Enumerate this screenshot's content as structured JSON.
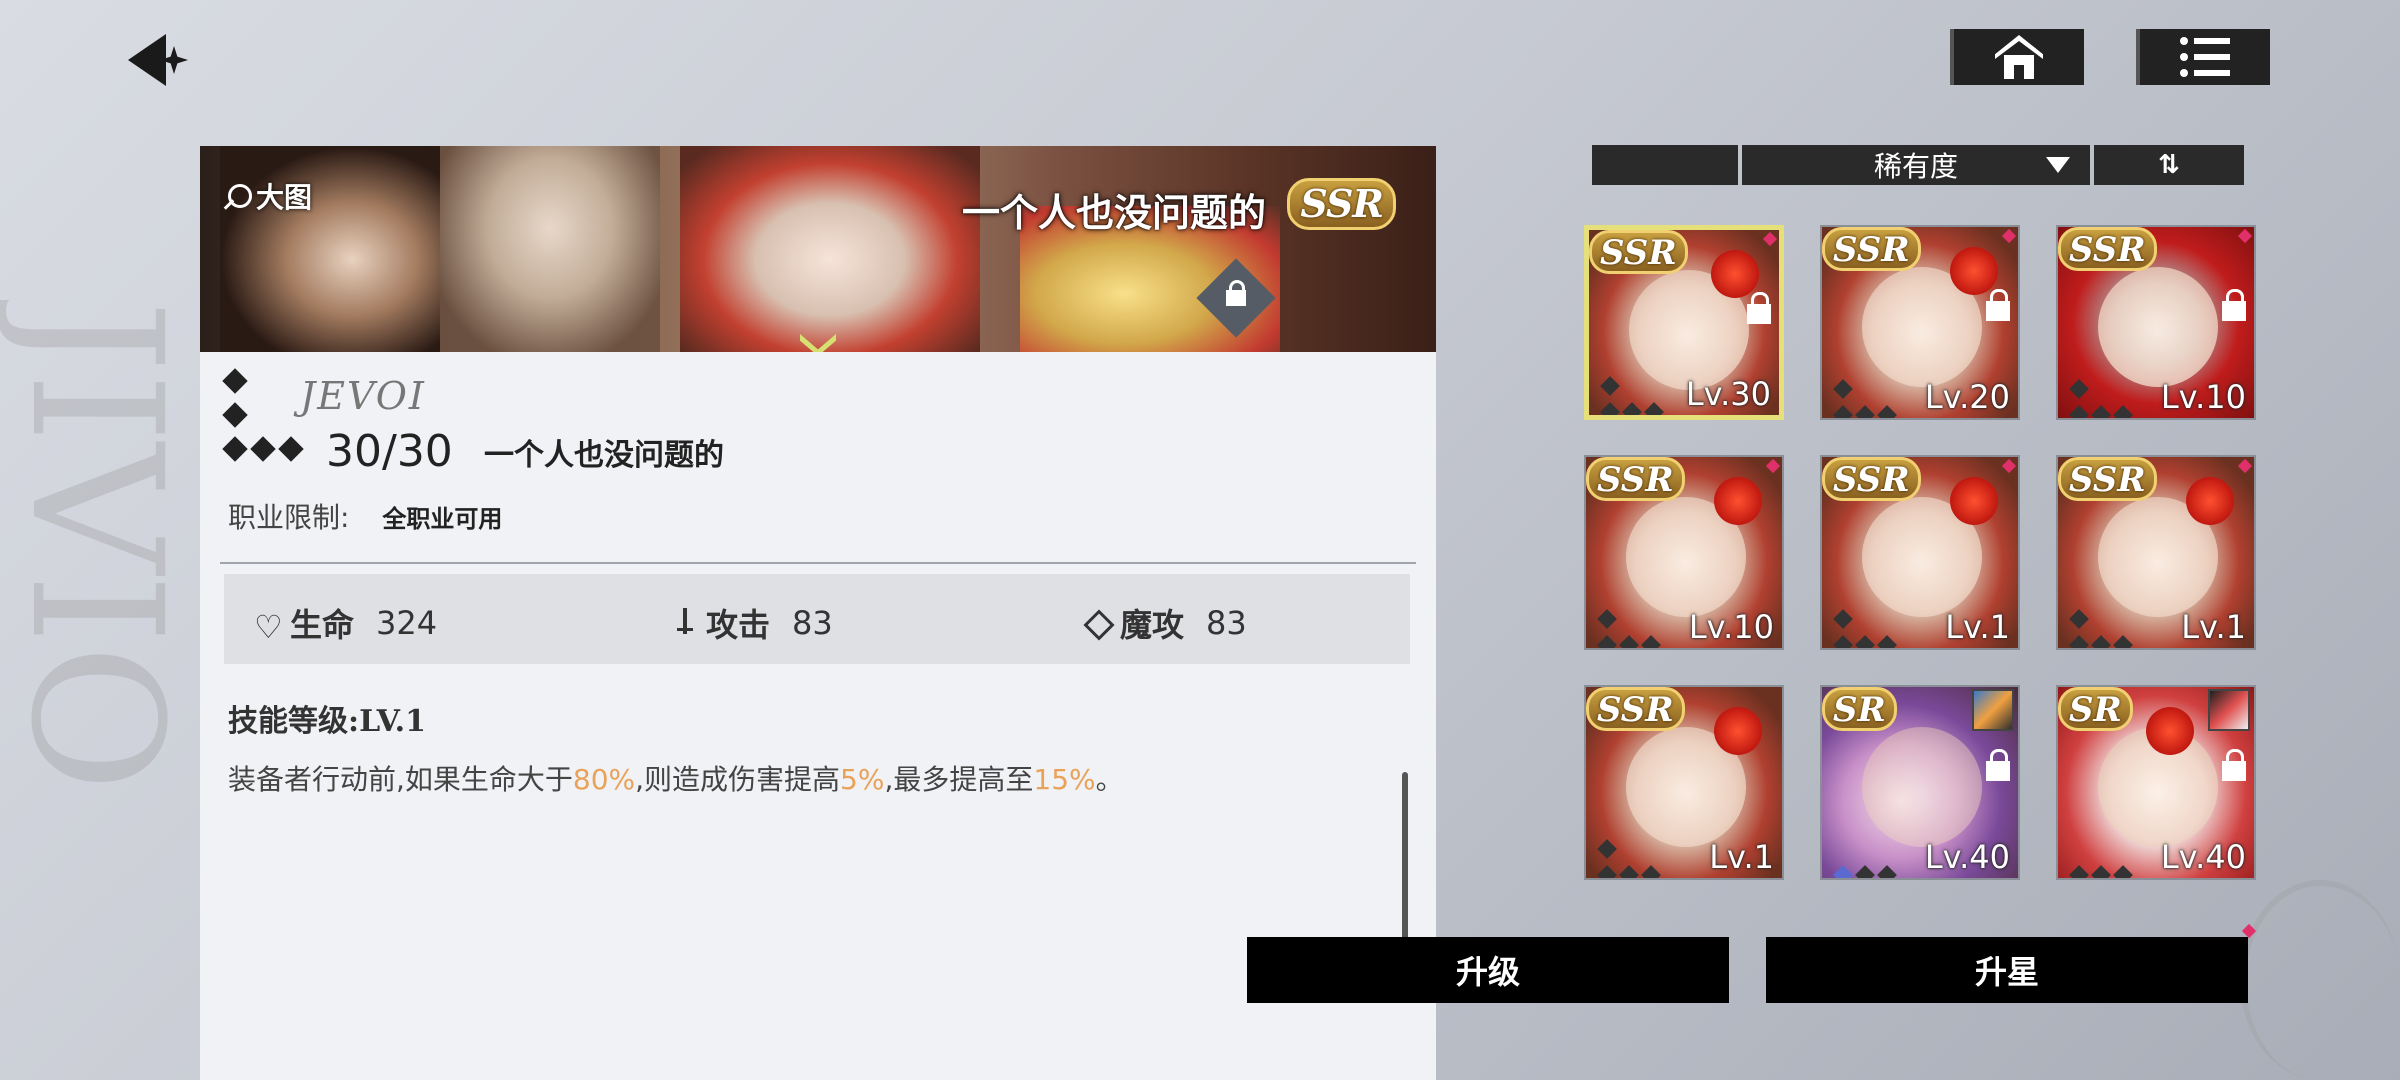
{
  "nav": {
    "home_icon": "home-icon",
    "menu_icon": "list-icon"
  },
  "banner": {
    "zoom_label": "大图",
    "title": "一个人也没问题的",
    "rarity": "SSR"
  },
  "item": {
    "brand": "JEVOI",
    "level": "30/30",
    "name": "一个人也没问题的",
    "class_label": "职业限制:",
    "class_value": "全职业可用",
    "stats": [
      {
        "label": "生命",
        "value": "324"
      },
      {
        "label": "攻击",
        "value": "83"
      },
      {
        "label": "魔攻",
        "value": "83"
      }
    ],
    "skill_level": "技能等级:LV.1",
    "skill_desc": {
      "p1": "装备者行动前,如果生命大于",
      "h1": "80%",
      "p2": ",则造成伤害提高",
      "h2": "5%",
      "p3": ",最多提高至",
      "h3": "15%",
      "p4": "。"
    }
  },
  "sort": {
    "label": "稀有度",
    "order_label": "⇅"
  },
  "cards": [
    {
      "rarity": "SSR",
      "level": "Lv.30",
      "locked": true
    },
    {
      "rarity": "SSR",
      "level": "Lv.20",
      "locked": true
    },
    {
      "rarity": "SSR",
      "level": "Lv.10",
      "locked": true
    },
    {
      "rarity": "SSR",
      "level": "Lv.10",
      "locked": false
    },
    {
      "rarity": "SSR",
      "level": "Lv.1",
      "locked": false
    },
    {
      "rarity": "SSR",
      "level": "Lv.1",
      "locked": false
    },
    {
      "rarity": "SSR",
      "level": "Lv.1",
      "locked": false
    },
    {
      "rarity": "SR",
      "level": "Lv.40",
      "locked": true
    },
    {
      "rarity": "SR",
      "level": "Lv.40",
      "locked": true
    }
  ],
  "actions": {
    "upgrade": "升级",
    "star_up": "升星"
  }
}
